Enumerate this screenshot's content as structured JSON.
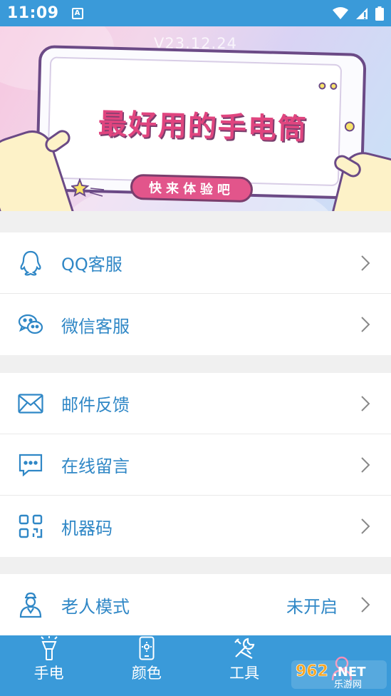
{
  "status_bar": {
    "time": "11:09",
    "notification_glyph": "A"
  },
  "banner": {
    "version": "V23.12.24",
    "title": "最好用的手电筒",
    "button": "快来体验吧"
  },
  "groups": [
    {
      "items": [
        {
          "label": "QQ客服",
          "icon": "qq-icon"
        },
        {
          "label": "微信客服",
          "icon": "wechat-icon"
        }
      ]
    },
    {
      "items": [
        {
          "label": "邮件反馈",
          "icon": "mail-icon"
        },
        {
          "label": "在线留言",
          "icon": "message-icon"
        },
        {
          "label": "机器码",
          "icon": "qrcode-icon"
        }
      ]
    },
    {
      "items": [
        {
          "label": "老人模式",
          "value": "未开启",
          "icon": "elder-icon"
        }
      ]
    }
  ],
  "bottom_nav": [
    {
      "label": "手电",
      "icon": "flashlight-icon"
    },
    {
      "label": "颜色",
      "icon": "phone-color-icon"
    },
    {
      "label": "工具",
      "icon": "tools-icon"
    },
    {
      "label": "",
      "icon": "user-icon"
    }
  ],
  "watermark": {
    "text": "962.NET",
    "subtext": "乐游网"
  },
  "colors": {
    "primary": "#3a9ad9",
    "text_accent": "#2f87c6",
    "background": "#f0f0f0"
  }
}
